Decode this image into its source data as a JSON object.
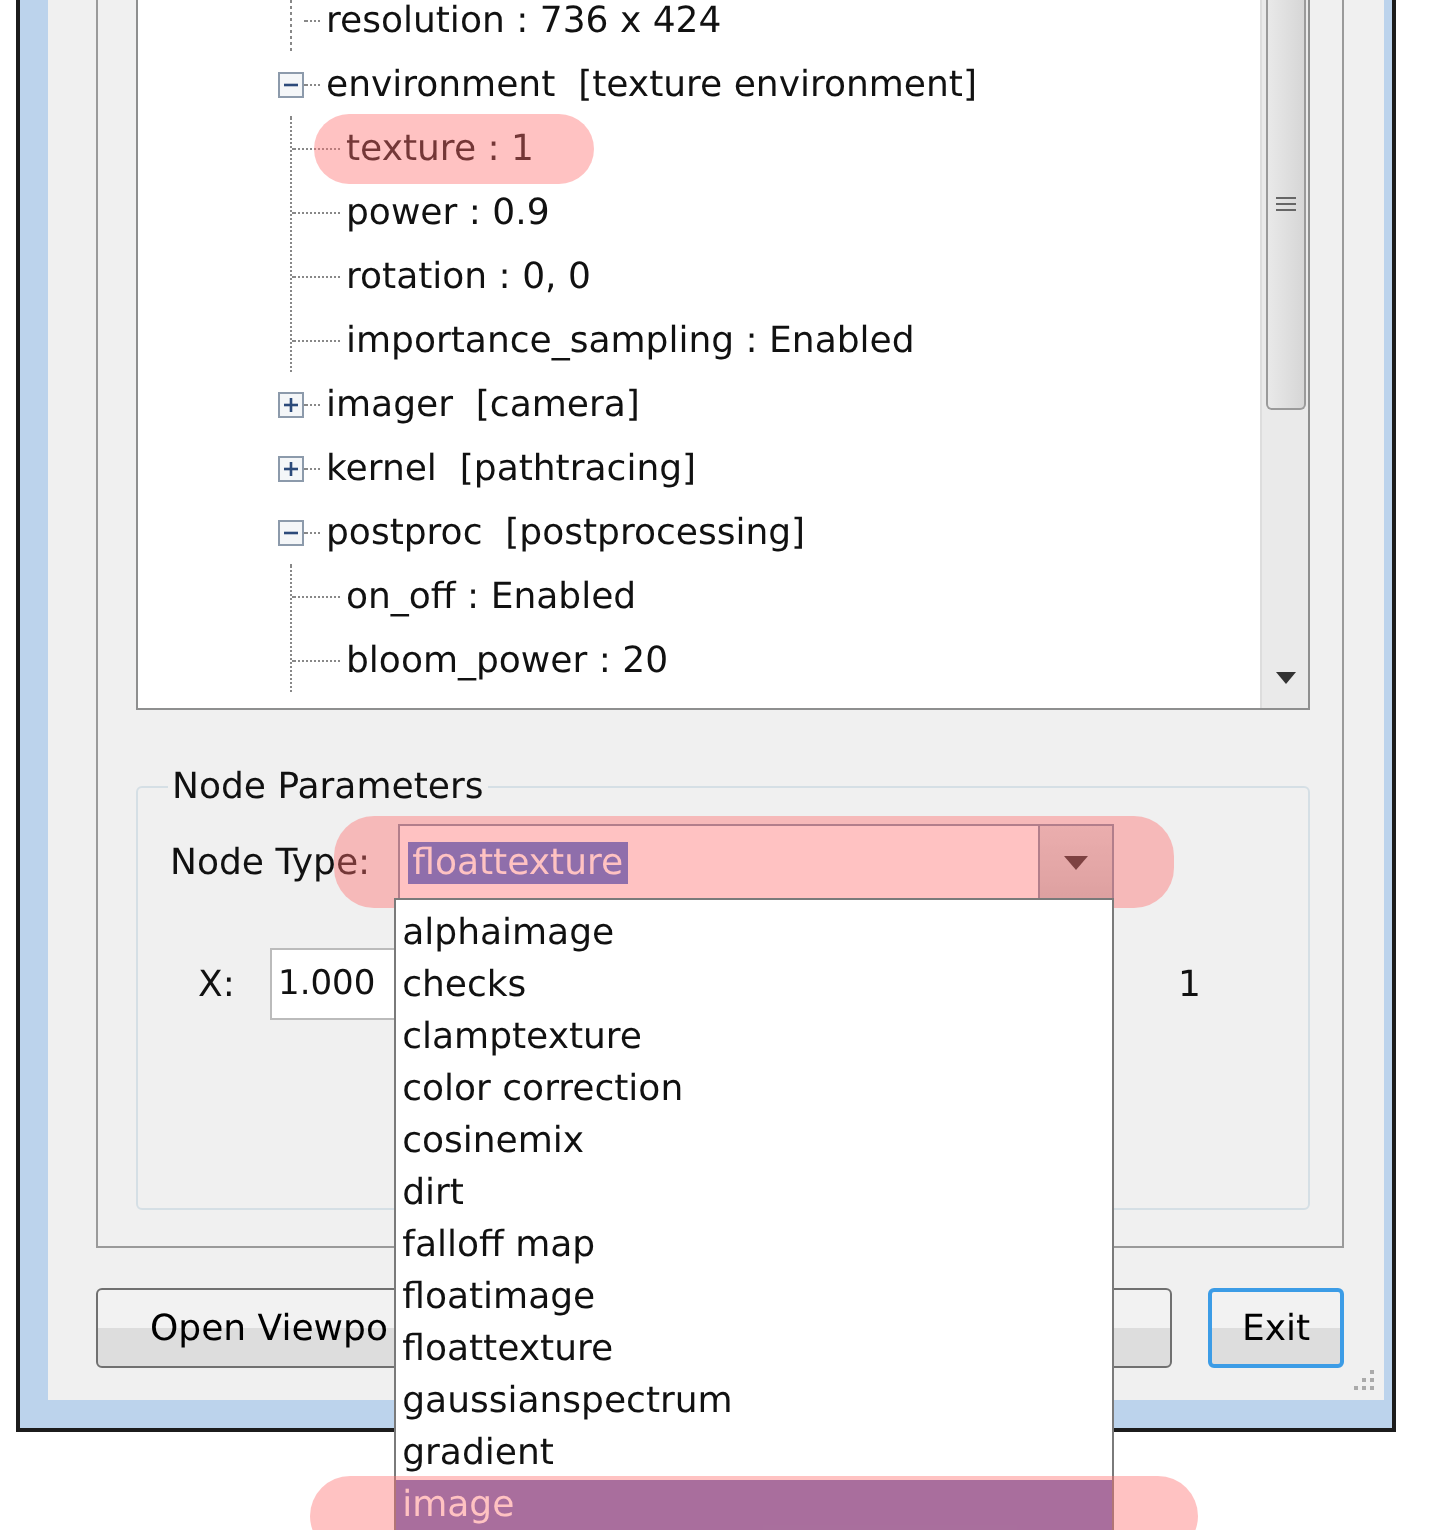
{
  "tree": [
    {
      "label": "resolution : 736 x 424"
    },
    {
      "label": "environment  [texture environment]",
      "expanded": true,
      "children": [
        {
          "label": "texture : 1",
          "highlighted": true
        },
        {
          "label": "power : 0.9",
          "highlighted": false
        },
        {
          "label": "rotation : 0, 0",
          "highlighted": false
        },
        {
          "label": "importance_sampling : Enabled",
          "highlighted": false
        }
      ]
    },
    {
      "label": "imager  [camera]",
      "expanded": false
    },
    {
      "label": "kernel  [pathtracing]",
      "expanded": false
    },
    {
      "label": "postproc  [postprocessing]",
      "expanded": true,
      "children": [
        {
          "label": "on_off : Enabled",
          "highlighted": false
        },
        {
          "label": "bloom_power : 20",
          "highlighted": false
        }
      ]
    }
  ],
  "node_parameters": {
    "title": "Node Parameters",
    "node_type_label": "Node Type:",
    "node_type_value": "floattexture",
    "highlighted": true,
    "x_label": "X:",
    "x_value": "1.000",
    "right_value": "1"
  },
  "dropdown": [
    {
      "label": "alphaimage",
      "selected": false,
      "highlighted": false
    },
    {
      "label": "checks",
      "selected": false,
      "highlighted": false
    },
    {
      "label": "clamptexture",
      "selected": false,
      "highlighted": false
    },
    {
      "label": "color correction",
      "selected": false,
      "highlighted": false
    },
    {
      "label": "cosinemix",
      "selected": false,
      "highlighted": false
    },
    {
      "label": "dirt",
      "selected": false,
      "highlighted": false
    },
    {
      "label": "falloff map",
      "selected": false,
      "highlighted": false
    },
    {
      "label": "floatimage",
      "selected": false,
      "highlighted": false
    },
    {
      "label": "floattexture",
      "selected": false,
      "highlighted": false
    },
    {
      "label": "gaussianspectrum",
      "selected": false,
      "highlighted": false
    },
    {
      "label": "gradient",
      "selected": false,
      "highlighted": false
    },
    {
      "label": "image",
      "selected": true,
      "highlighted": true
    }
  ],
  "buttons": [
    {
      "label": "Open Viewpo",
      "kind": "normal"
    },
    {
      "label": "Exit",
      "kind": "default"
    }
  ]
}
